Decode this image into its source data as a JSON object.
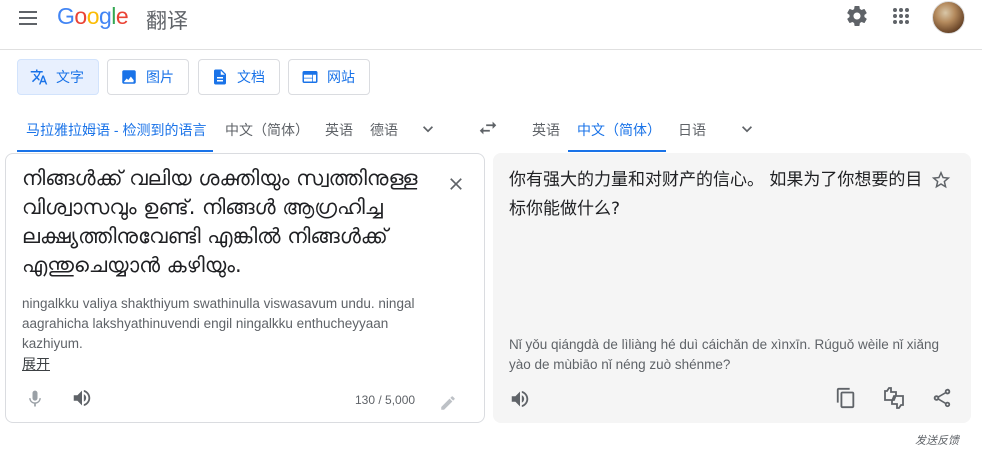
{
  "header": {
    "logo_text": "Google",
    "product_name": "翻译",
    "icons": [
      "menu-icon",
      "settings-icon",
      "apps-icon",
      "avatar"
    ]
  },
  "mode_tabs": [
    {
      "label": "文字",
      "icon": "translate-text-icon",
      "active": true
    },
    {
      "label": "图片",
      "icon": "image-icon",
      "active": false
    },
    {
      "label": "文档",
      "icon": "document-icon",
      "active": false
    },
    {
      "label": "网站",
      "icon": "website-icon",
      "active": false
    }
  ],
  "source_languages": [
    {
      "label": "马拉雅拉姆语 - 检测到的语言",
      "active": true
    },
    {
      "label": "中文（简体）",
      "active": false
    },
    {
      "label": "英语",
      "active": false
    },
    {
      "label": "德语",
      "active": false
    }
  ],
  "target_languages": [
    {
      "label": "英语",
      "active": false
    },
    {
      "label": "中文（简体）",
      "active": true
    },
    {
      "label": "日语",
      "active": false
    }
  ],
  "source": {
    "text": "നിങ്ങൾക്ക് വലിയ ശക്തിയും സ്വത്തിനുള്ള വിശ്വാസവും ഉണ്ട്. നിങ്ങൾ ആഗ്രഹിച്ച ലക്ഷ്യത്തിനുവേണ്ടി എങ്കിൽ നിങ്ങൾക്ക് എന്തുചെയ്യാൻ കഴിയും.",
    "transliteration": "ningalkku valiya shakthiyum swathinulla viswasavum undu. ningal aagrahicha lakshyathinuvendi engil ningalkku enthucheyyaan kazhiyum.",
    "expand_label": "展开",
    "char_count": "130 / 5,000"
  },
  "target": {
    "text": "你有强大的力量和对财产的信心。 如果为了你想要的目标你能做什么?",
    "transliteration": "Nǐ yǒu qiángdà de lìliàng hé duì cáichǎn de xìnxīn. Rúguǒ wèile nǐ xiǎng yào de mùbiāo nǐ néng zuò shénme?"
  },
  "feedback_label": "发送反馈",
  "colors": {
    "accent": "#1a73e8",
    "active_tab_bg": "#e8f0fe",
    "target_panel_bg": "#f5f5f5",
    "icon_gray": "#5f6368"
  }
}
